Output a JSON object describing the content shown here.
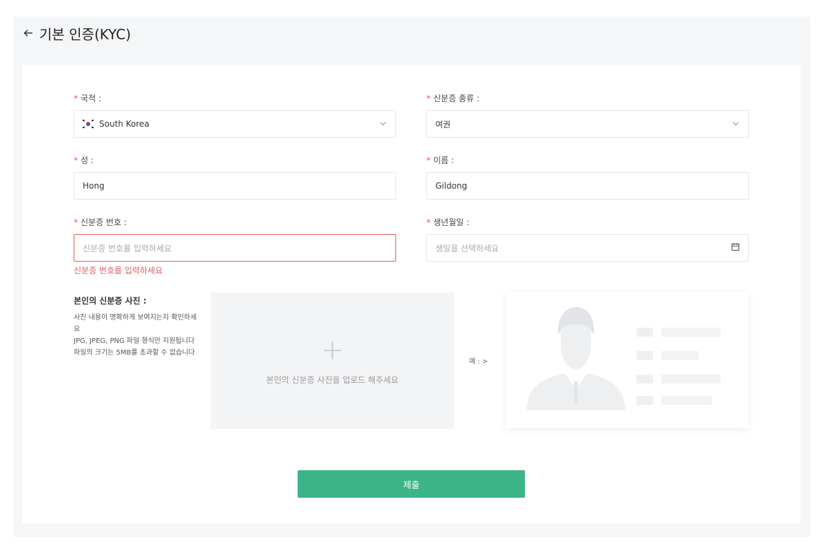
{
  "header": {
    "title": "기본 인증(KYC)"
  },
  "form": {
    "nationality": {
      "label": "국적 :",
      "value": "South Korea",
      "flag_icon": "south-korea-flag-icon"
    },
    "id_type": {
      "label": "신분증 종류 :",
      "value": "여권"
    },
    "last_name": {
      "label": "성 :",
      "value": "Hong"
    },
    "first_name": {
      "label": "이름 :",
      "value": "Gildong"
    },
    "id_number": {
      "label": "신분증 번호 :",
      "placeholder": "신분증 번호를 입력하세요",
      "error": "신분증 번호를 입력하세요"
    },
    "birthdate": {
      "label": "생년월일 :",
      "placeholder": "생일을 선택하세요"
    },
    "required_mark": "*"
  },
  "upload": {
    "title": "본인의 신분증 사진 :",
    "desc1": "사진 내용이 명확하게 보여지는지 확인하세요",
    "desc2": "JPG, JPEG, PNG 파일 형식만 지원됩니다",
    "desc3": "파일의 크기는 5MB를 초과할 수 없습니다",
    "plus": "+",
    "hint": "본인의 신분증 사진을 업로드 해주세요",
    "example_label": "예 : >"
  },
  "submit_label": "제출",
  "colors": {
    "accent": "#3db487",
    "error": "#e05b5b",
    "required": "#e8534a"
  }
}
